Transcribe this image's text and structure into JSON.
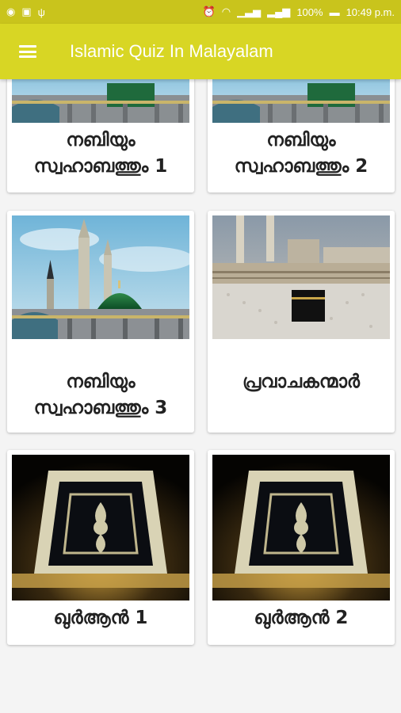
{
  "status_bar": {
    "battery": "100%",
    "time": "10:49 p.m."
  },
  "app_bar": {
    "title": "Islamic Quiz In Malayalam",
    "menu_icon": "hamburger-menu-icon"
  },
  "cards": [
    {
      "label": "നബിയും സ്വഹാബത്തും 1",
      "image": "mosque-dome-image"
    },
    {
      "label": "നബിയും സ്വഹാബത്തും 2",
      "image": "mosque-dome-image"
    },
    {
      "label": "നബിയും സ്വഹാബത്തും 3",
      "image": "mosque-dome-image"
    },
    {
      "label": "പ്രവാചകന്മാർ",
      "image": "kaaba-image"
    },
    {
      "label": "ഖുർആൻ 1",
      "image": "quran-image"
    },
    {
      "label": "ഖുർആൻ 2",
      "image": "quran-image"
    }
  ],
  "colors": {
    "status_bar": "#c9c41c",
    "app_bar": "#d8d624",
    "background": "#f4f4f4"
  }
}
